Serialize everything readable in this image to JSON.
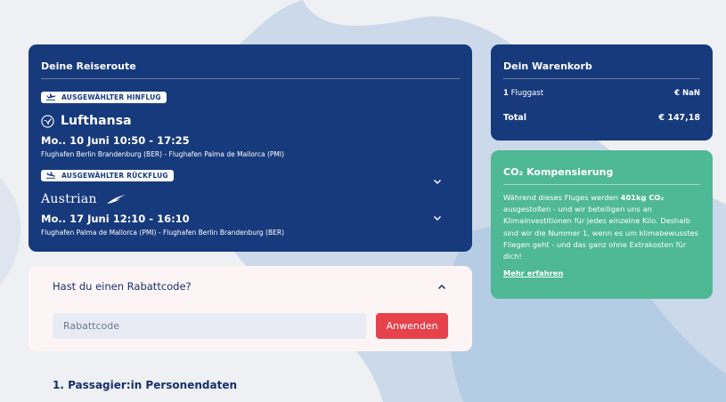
{
  "route": {
    "title": "Deine Reiseroute",
    "outbound": {
      "badge": "AUSGEWÄHLTER HINFLUG",
      "airline": "Lufthansa",
      "time": "Mo.. 10 Juni 10:50 - 17:25",
      "airports": "Flughafen Berlin Brandenburg (BER) - Flughafen Palma de Mallorca (PMI)"
    },
    "return": {
      "badge": "AUSGEWÄHLTER RÜCKFLUG",
      "airline": "Austrian",
      "time": "Mo.. 17 Juni 12:10 - 16:10",
      "airports": "Flughafen Palma de Mallorca (PMI) - Flughafen Berlin Brandenburg (BER)"
    }
  },
  "cart": {
    "title": "Dein Warenkorb",
    "passenger_count": "1",
    "passenger_label": "Fluggast",
    "passenger_price": "€ NaN",
    "total_label": "Total",
    "total_price": "€ 147,18"
  },
  "co2": {
    "title": "CO₂ Kompensierung",
    "text_before": "Während dieses Fluges werden ",
    "amount": "401kg CO₂",
    "text_after": " ausgestoßen - und wir beteiligen uns an Klimainvestitionen für jedes einzelne Kilo. Deshalb sind wir die Nummer 1, wenn es um klimabewusstes Fliegen geht - und das ganz ohne Extrakosten für dich!",
    "link": "Mehr erfahren"
  },
  "discount": {
    "title": "Hast du einen Rabattcode?",
    "placeholder": "Rabattcode",
    "value": "",
    "button": "Anwenden"
  },
  "passenger_section": {
    "title": "1. Passagier:in Personendaten"
  },
  "colors": {
    "navy": "#173a7c",
    "green": "#4fb894",
    "red": "#e6424c",
    "text": "#16306b"
  }
}
